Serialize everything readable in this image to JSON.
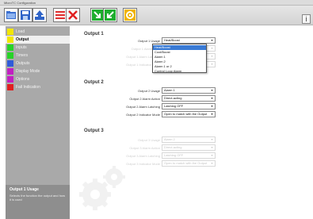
{
  "window": {
    "title": "MicroTC Configuration"
  },
  "toolbar": {
    "buttons": [
      {
        "name": "open-icon"
      },
      {
        "name": "save-icon"
      },
      {
        "name": "upload-icon"
      },
      {
        "name": "list-clear-icon"
      },
      {
        "name": "download-icon"
      },
      {
        "name": "export-icon"
      },
      {
        "name": "settings-icon"
      }
    ],
    "help_label": "i"
  },
  "sidebar": {
    "items": [
      {
        "label": "Load",
        "color": "#f2e600"
      },
      {
        "label": "Output",
        "color": "#f2e600"
      },
      {
        "label": "Inputs",
        "color": "#27d327"
      },
      {
        "label": "Timers",
        "color": "#27d327"
      },
      {
        "label": "Outputs",
        "color": "#2f5bd9"
      },
      {
        "label": "Display Mode",
        "color": "#c21fc2"
      },
      {
        "label": "Options",
        "color": "#c21fc2"
      },
      {
        "label": "Fail Indication",
        "color": "#e02020"
      }
    ],
    "info_title": "Output 1 Usage",
    "info_text": "Selects the function the output and how it is used"
  },
  "main": {
    "sections": [
      {
        "title": "Output 1",
        "rows": [
          {
            "label": "Output 1 Usage",
            "value": "Heat/Boost"
          },
          {
            "label": "Output 1 Alarm Type",
            "value": ""
          },
          {
            "label": "Output 1 Alarm Latching",
            "value": ""
          },
          {
            "label": "Output 1 Indicator Mode",
            "value": ""
          }
        ]
      },
      {
        "title": "Output 2",
        "rows": [
          {
            "label": "Output 2 Usage",
            "value": "Alarm 1"
          },
          {
            "label": "Output 2 Alarm Action",
            "value": "Direct-acting"
          },
          {
            "label": "Output 2 Alarm Latching",
            "value": "Latching OFF"
          },
          {
            "label": "Output 2 Indicator Mode",
            "value": "Open to match with the Output"
          }
        ]
      },
      {
        "title": "Output 3",
        "rows": [
          {
            "label": "Output 3 Usage",
            "value": "Alarm 2"
          },
          {
            "label": "Output 3 Alarm Action",
            "value": "Direct-acting"
          },
          {
            "label": "Output 3 Alarm Latching",
            "value": "Latching OFF"
          },
          {
            "label": "Output 3 Indicator Mode",
            "value": "Open to match with the Output"
          }
        ]
      }
    ],
    "dropdown_options": [
      "Heat/Boost",
      "Cool/Boost",
      "Alarm 1",
      "Alarm 2",
      "Alarm 1 or 2",
      "Control Loop Alarm"
    ],
    "dropdown_highlighted": "Heat/Boost"
  }
}
